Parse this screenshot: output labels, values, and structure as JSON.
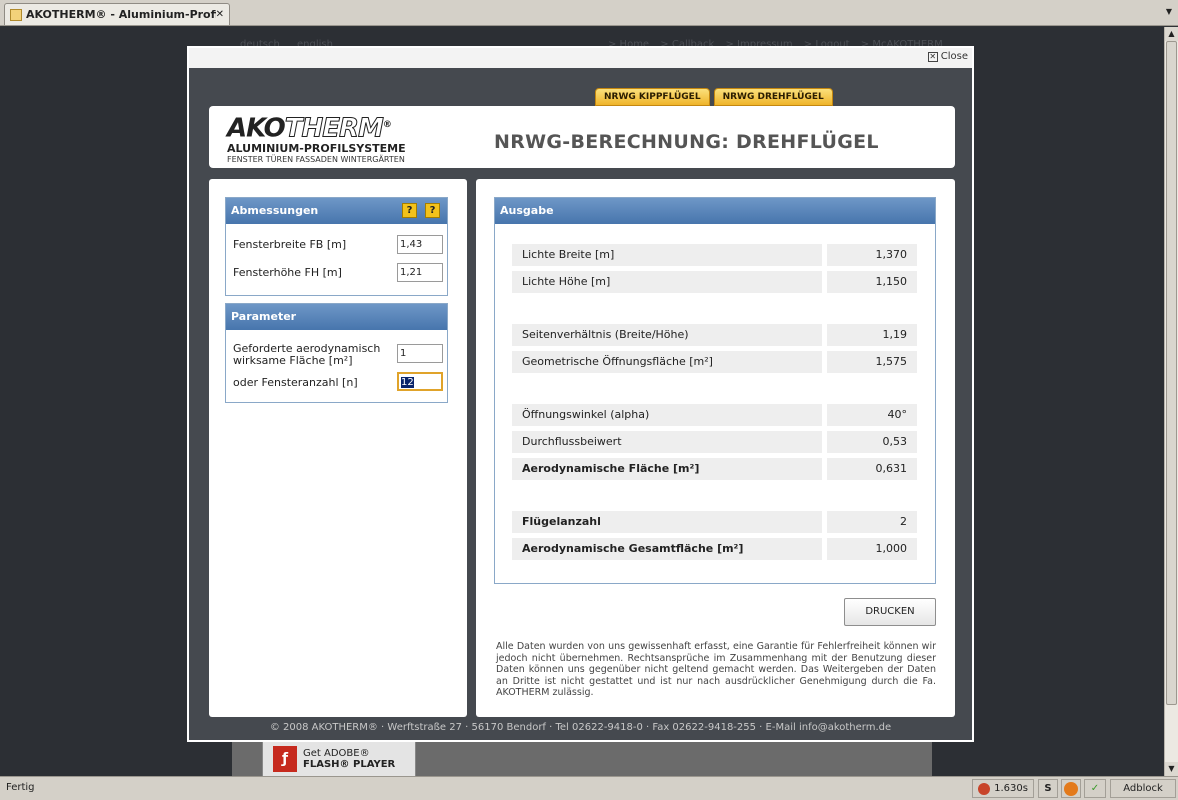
{
  "browser": {
    "tab_title": "AKOTHERM® - Aluminium-Profils...",
    "status": "Fertig",
    "timing": "1.630s",
    "addon_label": "Adblock"
  },
  "background": {
    "lang_links": [
      "deutsch",
      "english"
    ],
    "nav_links": [
      "> Home",
      "> Callback",
      "> Impressum",
      "> Logout",
      "> McAKOTHERM"
    ],
    "flash_line1": "Get ADOBE®",
    "flash_line2": "FLASH® PLAYER"
  },
  "lightbox": {
    "close_label": "Close"
  },
  "tabs": [
    "NRWG KIPPFLÜGEL",
    "NRWG DREHFLÜGEL"
  ],
  "logo": {
    "word_part1": "AKO",
    "word_part2": "THERM",
    "reg": "®",
    "line1": "ALUMINIUM-PROFILSYSTEME",
    "line2": "FENSTER TÜREN FASSADEN WINTERGÄRTEN"
  },
  "page_title": "NRWG-BERECHNUNG: DREHFLÜGEL",
  "abmessungen": {
    "title": "Abmessungen",
    "help1": "?",
    "help2": "?",
    "breite_label": "Fensterbreite FB [m]",
    "breite_value": "1,43",
    "hoehe_label": "Fensterhöhe FH [m]",
    "hoehe_value": "1,21"
  },
  "parameter": {
    "title": "Parameter",
    "flaeche_label_1": "Geforderte aerodynamisch",
    "flaeche_label_2": "wirksame Fläche [m²]",
    "flaeche_value": "1",
    "anzahl_label": "oder Fensteranzahl [n]",
    "anzahl_value": "12"
  },
  "ausgabe": {
    "title": "Ausgabe",
    "rows": [
      {
        "label": "Lichte Breite [m]",
        "value": "1,370"
      },
      {
        "label": "Lichte Höhe [m]",
        "value": "1,150"
      },
      {
        "label": "Seitenverhältnis (Breite/Höhe)",
        "value": "1,19"
      },
      {
        "label": "Geometrische Öffnungsfläche [m²]",
        "value": "1,575"
      },
      {
        "label": "Öffnungswinkel (alpha)",
        "value": "40°"
      },
      {
        "label": "Durchflussbeiwert",
        "value": "0,53"
      },
      {
        "label": "Aerodynamische Fläche [m²]",
        "value": "0,631"
      },
      {
        "label": "Flügelanzahl",
        "value": "2"
      },
      {
        "label": "Aerodynamische Gesamtfläche [m²]",
        "value": "1,000"
      }
    ]
  },
  "print_button": "DRUCKEN",
  "disclaimer": "Alle Daten wurden von uns gewissenhaft erfasst, eine Garantie für Fehlerfreiheit können wir jedoch nicht übernehmen. Rechtsansprüche im Zusammenhang mit der Benutzung dieser Daten können uns gegenüber nicht geltend gemacht werden. Das Weitergeben der Daten an Dritte ist nicht gestattet und ist nur nach ausdrücklicher Genehmigung durch die Fa. AKOTHERM zulässig.",
  "footer": "© 2008 AKOTHERM® · Werftstraße 27 · 56170 Bendorf · Tel 02622-9418-0 · Fax 02622-9418-255 · E-Mail info@akotherm.de",
  "colors": {
    "header_blue": "#4775ad",
    "tab_orange": "#efb42a",
    "overlay": "#2c2f34"
  }
}
